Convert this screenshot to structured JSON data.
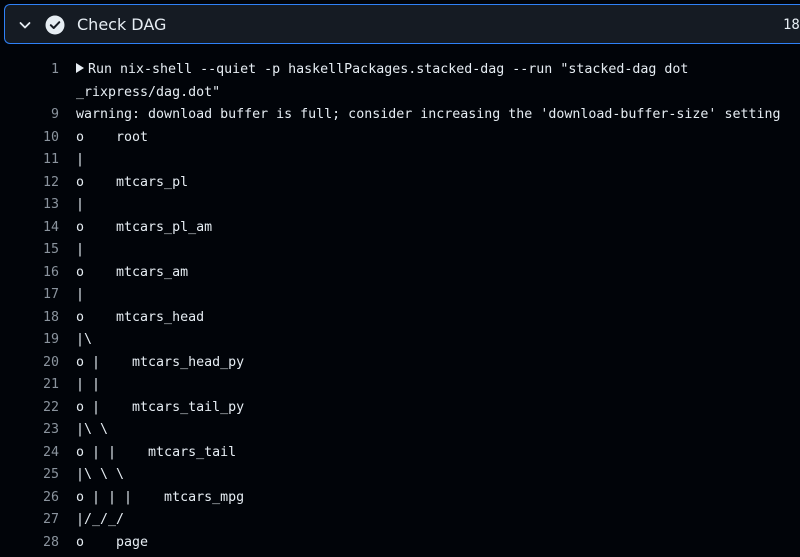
{
  "step": {
    "title": "Check DAG",
    "duration": "18",
    "status": "success",
    "accent_color": "#2f81f7",
    "icons": [
      "chevron-down-icon",
      "check-circle-icon",
      "caret-right-icon"
    ]
  },
  "log": [
    {
      "num": "1",
      "text": "Run nix-shell --quiet -p haskellPackages.stacked-dag --run \"stacked-dag dot",
      "collapsible": true
    },
    {
      "num": "",
      "text": "_rixpress/dag.dot\""
    },
    {
      "num": "9",
      "text": "warning: download buffer is full; consider increasing the 'download-buffer-size' setting"
    },
    {
      "num": "10",
      "text": "o    root"
    },
    {
      "num": "11",
      "text": "|"
    },
    {
      "num": "12",
      "text": "o    mtcars_pl"
    },
    {
      "num": "13",
      "text": "|"
    },
    {
      "num": "14",
      "text": "o    mtcars_pl_am"
    },
    {
      "num": "15",
      "text": "|"
    },
    {
      "num": "16",
      "text": "o    mtcars_am"
    },
    {
      "num": "17",
      "text": "|"
    },
    {
      "num": "18",
      "text": "o    mtcars_head"
    },
    {
      "num": "19",
      "text": "|\\"
    },
    {
      "num": "20",
      "text": "o |    mtcars_head_py"
    },
    {
      "num": "21",
      "text": "| |"
    },
    {
      "num": "22",
      "text": "o |    mtcars_tail_py"
    },
    {
      "num": "23",
      "text": "|\\ \\"
    },
    {
      "num": "24",
      "text": "o | |    mtcars_tail"
    },
    {
      "num": "25",
      "text": "|\\ \\ \\"
    },
    {
      "num": "26",
      "text": "o | | |    mtcars_mpg"
    },
    {
      "num": "27",
      "text": "|/_/_/"
    },
    {
      "num": "28",
      "text": "o    page"
    }
  ]
}
